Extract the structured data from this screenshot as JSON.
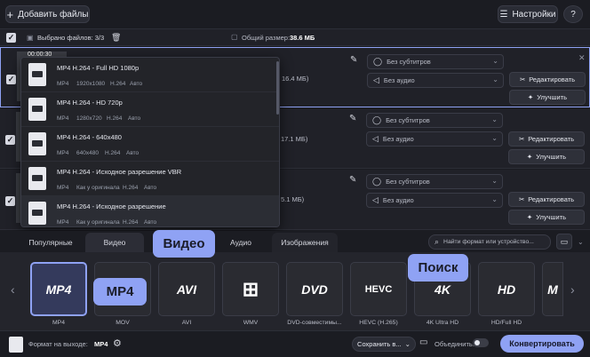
{
  "toolbar": {
    "add_files": "Добавить файлы",
    "settings": "Настройки",
    "help": "?"
  },
  "subbar": {
    "selected": "Выбрано файлов: 3/3",
    "total_size_label": "Общий размер:",
    "total_size": "38.6 МБ"
  },
  "rows": [
    {
      "duration": "00:00:30",
      "size": "16.4 МБ)",
      "subs": "Без субтитров",
      "audio": "Без аудио",
      "edit": "Редактировать",
      "enhance": "Улучшить"
    },
    {
      "duration": "",
      "size": "17.1 МБ)",
      "subs": "Без субтитров",
      "audio": "Без аудио",
      "edit": "Редактировать",
      "enhance": "Улучшить"
    },
    {
      "duration": "",
      "size": "5.1 МБ)",
      "subs": "Без субтитров",
      "audio": "Без аудио",
      "edit": "Редактировать",
      "enhance": "Улучшить"
    }
  ],
  "dropdown": [
    {
      "title": "MP4 H.264 - Full HD 1080p",
      "meta": [
        "MP4",
        "1920x1080",
        "H.264",
        "Авто"
      ]
    },
    {
      "title": "MP4 H.264 - HD 720p",
      "meta": [
        "MP4",
        "1280x720",
        "H.264",
        "Авто"
      ]
    },
    {
      "title": "MP4 H.264 - 640x480",
      "meta": [
        "MP4",
        "640x480",
        "H.264",
        "Авто"
      ]
    },
    {
      "title": "MP4 H.264 - Исходное разрешение VBR",
      "meta": [
        "MP4",
        "Как у оригинала",
        "H.264",
        "Авто"
      ]
    },
    {
      "title": "MP4 H.264 - Исходное разрешение",
      "meta": [
        "MP4",
        "Как у оригинала",
        "H.264",
        "Авто"
      ]
    }
  ],
  "tabs": {
    "popular": "Популярные",
    "video": "Видео",
    "audio": "Аудио",
    "images": "Изображения"
  },
  "search": {
    "placeholder": "Найти формат или устройство..."
  },
  "formats": [
    {
      "logo": "MP4",
      "label": "MP4"
    },
    {
      "logo": "",
      "label": "MOV"
    },
    {
      "logo": "AVI",
      "label": "AVI"
    },
    {
      "logo": "",
      "label": "WMV"
    },
    {
      "logo": "DVD",
      "label": "DVD-совместимы..."
    },
    {
      "logo": "HEVC",
      "label": "HEVC (H.265)"
    },
    {
      "logo": "4K",
      "label": "4K Ultra HD"
    },
    {
      "logo": "HD",
      "label": "HD/Full HD"
    },
    {
      "logo": "M",
      "label": ""
    }
  ],
  "callouts": {
    "video": "Видео",
    "mp4": "MP4",
    "search": "Поиск"
  },
  "bottom": {
    "output_label": "Формат на выходе:",
    "output_value": "MP4",
    "save": "Сохранить в...",
    "merge": "Объединить:",
    "convert": "Конвертировать"
  },
  "colors": {
    "accent": "#8fa2f4",
    "background": "#1b1c22",
    "panel": "#202128"
  }
}
